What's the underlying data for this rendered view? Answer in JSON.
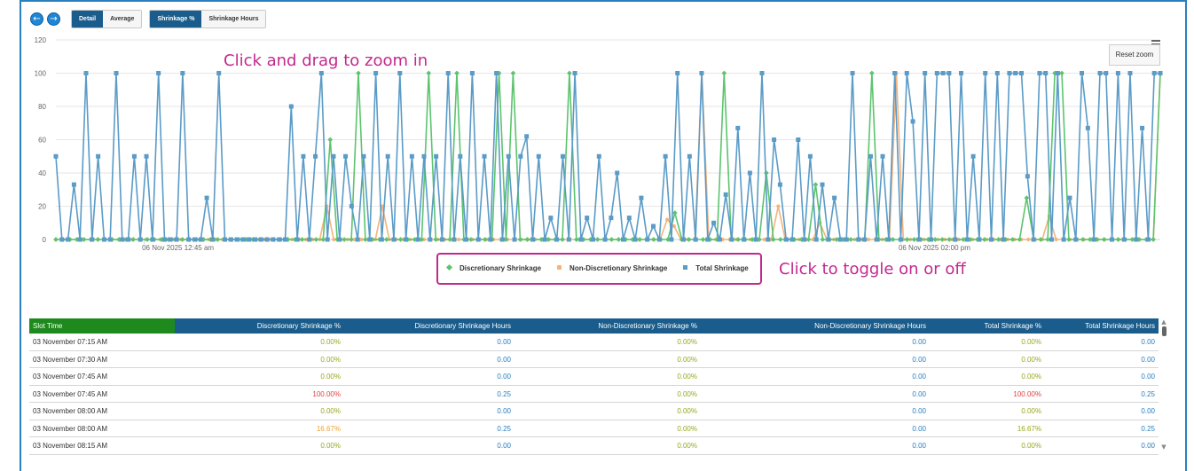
{
  "toolbar": {
    "prev_icon": "left-arrow-circle",
    "next_icon": "right-arrow-circle",
    "view_tabs": [
      "Detail",
      "Average"
    ],
    "active_view": "Detail",
    "metric_tabs": [
      "Shrinkage %",
      "Shrinkage Hours"
    ],
    "active_metric": "Shrinkage %"
  },
  "hints": {
    "zoom": "Click and drag to zoom in",
    "toggle": "Click to toggle on or off"
  },
  "reset_zoom": "Reset zoom",
  "chart_data": {
    "type": "line",
    "ylim": [
      0,
      120
    ],
    "yticks": [
      0,
      20,
      40,
      60,
      80,
      100,
      120
    ],
    "xtick_labels": [
      "06 Nov 2025 12:45 am",
      "06 Nov 2025 02:00 pm"
    ],
    "grid": true,
    "legend_position": "bottom-center",
    "colors": {
      "discretionary": "#5cc46e",
      "non_discretionary": "#f5b37a",
      "total": "#5a9bc7"
    },
    "series": [
      {
        "name": "Discretionary Shrinkage",
        "values": [
          0,
          0,
          0,
          0,
          0,
          0,
          0,
          0,
          0,
          0,
          0,
          0,
          0,
          0,
          0,
          0,
          0,
          0,
          0,
          0,
          0,
          0,
          0,
          0,
          0,
          0,
          0,
          0,
          0,
          0,
          0,
          0,
          0,
          0,
          0,
          0,
          0,
          0,
          0,
          60,
          0,
          0,
          0,
          100,
          0,
          0,
          0,
          0,
          0,
          0,
          0,
          0,
          0,
          100,
          0,
          0,
          0,
          100,
          0,
          0,
          0,
          0,
          0,
          100,
          0,
          100,
          0,
          0,
          0,
          0,
          0,
          0,
          0,
          100,
          0,
          0,
          0,
          0,
          0,
          0,
          0,
          0,
          0,
          0,
          0,
          0,
          0,
          0,
          16,
          0,
          0,
          0,
          0,
          0,
          0,
          100,
          0,
          0,
          0,
          0,
          0,
          40,
          0,
          0,
          0,
          0,
          0,
          0,
          33,
          0,
          0,
          0,
          0,
          0,
          0,
          0,
          100,
          0,
          0,
          0,
          0,
          0,
          0,
          0,
          0,
          0,
          0,
          0,
          0,
          0,
          0,
          0,
          0,
          0,
          0,
          0,
          0,
          0,
          25,
          0,
          0,
          0,
          100,
          100,
          0,
          0,
          0,
          0,
          0,
          0,
          0,
          0,
          0,
          0,
          0,
          0,
          0,
          100
        ]
      },
      {
        "name": "Non-Discretionary Shrinkage",
        "values": [
          0,
          0,
          0,
          0,
          0,
          0,
          0,
          0,
          0,
          0,
          0,
          0,
          0,
          0,
          0,
          0,
          0,
          0,
          0,
          0,
          0,
          0,
          0,
          0,
          0,
          0,
          0,
          0,
          0,
          0,
          0,
          0,
          0,
          0,
          0,
          0,
          0,
          0,
          0,
          20,
          0,
          0,
          0,
          0,
          0,
          0,
          0,
          20,
          0,
          0,
          0,
          0,
          0,
          0,
          0,
          0,
          0,
          0,
          0,
          0,
          0,
          0,
          0,
          0,
          0,
          0,
          0,
          0,
          0,
          0,
          0,
          0,
          0,
          0,
          0,
          0,
          0,
          0,
          0,
          0,
          0,
          0,
          0,
          0,
          0,
          0,
          0,
          0,
          12,
          8,
          0,
          0,
          0,
          100,
          0,
          0,
          0,
          0,
          0,
          0,
          0,
          0,
          0,
          0,
          20,
          0,
          0,
          0,
          0,
          0,
          10,
          0,
          0,
          0,
          0,
          0,
          0,
          0,
          0,
          0,
          0,
          100,
          0,
          0,
          0,
          0,
          0,
          0,
          0,
          0,
          0,
          0,
          0,
          0,
          0,
          0,
          0,
          0,
          0,
          0,
          0,
          0,
          0,
          14,
          0,
          0,
          0,
          0,
          0,
          0,
          0,
          0,
          0,
          0,
          0,
          0,
          0,
          0,
          0,
          100
        ]
      },
      {
        "name": "Total Shrinkage",
        "values": [
          50,
          0,
          0,
          33,
          0,
          100,
          0,
          50,
          0,
          0,
          100,
          0,
          0,
          50,
          0,
          50,
          0,
          100,
          0,
          0,
          0,
          100,
          0,
          0,
          0,
          25,
          0,
          100,
          0,
          0,
          0,
          0,
          0,
          0,
          0,
          0,
          0,
          0,
          0,
          80,
          0,
          50,
          0,
          50,
          100,
          0,
          50,
          0,
          50,
          20,
          0,
          50,
          0,
          100,
          0,
          50,
          0,
          100,
          0,
          50,
          0,
          50,
          0,
          50,
          0,
          100,
          0,
          50,
          0,
          100,
          0,
          50,
          0,
          100,
          0,
          50,
          0,
          50,
          62,
          0,
          50,
          0,
          13,
          0,
          50,
          0,
          100,
          0,
          13,
          0,
          50,
          0,
          13,
          40,
          0,
          13,
          0,
          25,
          0,
          8,
          0,
          50,
          0,
          100,
          0,
          50,
          0,
          100,
          0,
          10,
          0,
          27,
          0,
          67,
          0,
          40,
          0,
          100,
          0,
          60,
          33,
          0,
          0,
          60,
          0,
          50,
          0,
          33,
          0,
          25,
          0,
          0,
          100,
          0,
          0,
          50,
          0,
          50,
          0,
          100,
          0,
          100,
          71,
          0,
          100,
          0,
          100,
          100,
          100,
          0,
          100,
          0,
          50,
          0,
          100,
          0,
          100,
          0,
          100,
          100,
          100,
          38,
          0,
          100,
          100,
          0,
          100,
          0,
          25,
          0,
          100,
          67,
          0,
          100,
          100,
          0,
          100,
          0,
          100,
          0,
          67,
          0,
          100,
          100
        ]
      }
    ]
  },
  "table": {
    "headers": [
      "Slot Time",
      "Discretionary Shrinkage %",
      "Discretionary Shrinkage Hours",
      "Non-Discretionary Shrinkage %",
      "Non-Discretionary Shrinkage Hours",
      "Total Shrinkage %",
      "Total Shrinkage Hours"
    ],
    "rows": [
      [
        "03 November 07:15 AM",
        "0.00%",
        "0.00",
        "0.00%",
        "0.00",
        "0.00%",
        "0.00"
      ],
      [
        "03 November 07:30 AM",
        "0.00%",
        "0.00",
        "0.00%",
        "0.00",
        "0.00%",
        "0.00"
      ],
      [
        "03 November 07:45 AM",
        "0.00%",
        "0.00",
        "0.00%",
        "0.00",
        "0.00%",
        "0.00"
      ],
      [
        "03 November 07:45 AM",
        "100.00%",
        "0.25",
        "0.00%",
        "0.00",
        "100.00%",
        "0.25"
      ],
      [
        "03 November 08:00 AM",
        "0.00%",
        "0.00",
        "0.00%",
        "0.00",
        "0.00%",
        "0.00"
      ],
      [
        "03 November 08:00 AM",
        "16.67%",
        "0.25",
        "0.00%",
        "0.00",
        "16.67%",
        "0.25"
      ],
      [
        "03 November 08:15 AM",
        "0.00%",
        "0.00",
        "0.00%",
        "0.00",
        "0.00%",
        "0.00"
      ]
    ]
  }
}
